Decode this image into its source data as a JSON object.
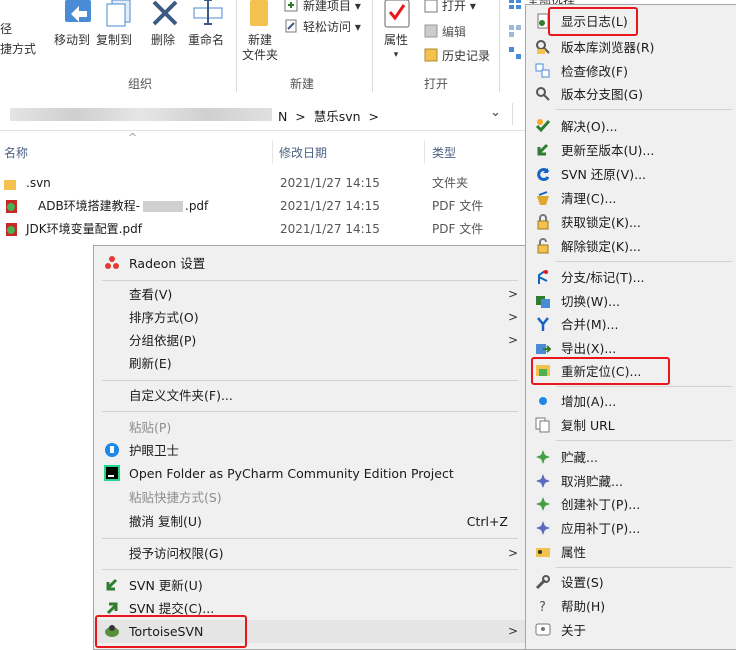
{
  "ribbon": {
    "partial_left_labels": [
      "径",
      "捷方式"
    ],
    "buttons": {
      "move_to": "移动到",
      "copy_to": "复制到",
      "delete": "删除",
      "rename": "重命名",
      "new_folder_line1": "新建",
      "new_folder_line2": "文件夹",
      "new_item": "新建项目",
      "easy_access": "轻松访问",
      "properties": "属性",
      "open": "打开",
      "edit": "编辑",
      "history": "历史记录",
      "select_all_partial": "全部选择"
    },
    "groups": {
      "organize": "组织",
      "new": "新建",
      "open": "打开"
    }
  },
  "address": {
    "path_suffix": "N  >  慧乐svn  >"
  },
  "columns": {
    "name": "名称",
    "date": "修改日期",
    "type": "类型"
  },
  "files": [
    {
      "name": ".svn",
      "date": "2021/1/27 14:15",
      "type": "文件夹"
    },
    {
      "name": "ADB环境搭建教程-",
      "name_suffix": ".pdf",
      "date": "2021/1/27 14:15",
      "type": "PDF 文件"
    },
    {
      "name": "JDK环境变量配置.pdf",
      "date": "2021/1/27 14:15",
      "type": "PDF 文件"
    }
  ],
  "context_menu": {
    "radeon": "Radeon 设置",
    "view": "查看(V)",
    "sort_by": "排序方式(O)",
    "group_by": "分组依据(P)",
    "refresh": "刷新(E)",
    "customize": "自定义文件夹(F)...",
    "paste": "粘贴(P)",
    "eye_guard": "护眼卫士",
    "pycharm": "Open Folder as PyCharm Community Edition Project",
    "paste_shortcut": "粘贴快捷方式(S)",
    "undo_copy": "撤消 复制(U)",
    "undo_shortcut": "Ctrl+Z",
    "grant_access": "授予访问权限(G)",
    "svn_update": "SVN 更新(U)",
    "svn_commit": "SVN 提交(C)...",
    "tortoise": "TortoiseSVN"
  },
  "svn_menu": {
    "show_log": "显示日志(L)",
    "repo_browser": "版本库浏览器(R)",
    "check_mods": "检查修改(F)",
    "revision_graph": "版本分支图(G)",
    "resolve": "解决(O)...",
    "update_to_rev": "更新至版本(U)...",
    "revert": "SVN 还原(V)...",
    "cleanup": "清理(C)...",
    "get_lock": "获取锁定(K)...",
    "release_lock": "解除锁定(K)...",
    "branch_tag": "分支/标记(T)...",
    "switch": "切换(W)...",
    "merge": "合并(M)...",
    "export": "导出(X)...",
    "relocate": "重新定位(C)...",
    "add": "增加(A)...",
    "copy_url": "复制 URL",
    "shelve": "贮藏...",
    "unshelve": "取消贮藏...",
    "create_patch": "创建补丁(P)...",
    "apply_patch": "应用补丁(P)...",
    "properties": "属性",
    "settings": "设置(S)",
    "help": "帮助(H)",
    "about": "关于"
  },
  "colors": {
    "highlight": "#e8171c",
    "menu_bg": "#f0f0f0",
    "header_text": "#4d6082"
  }
}
